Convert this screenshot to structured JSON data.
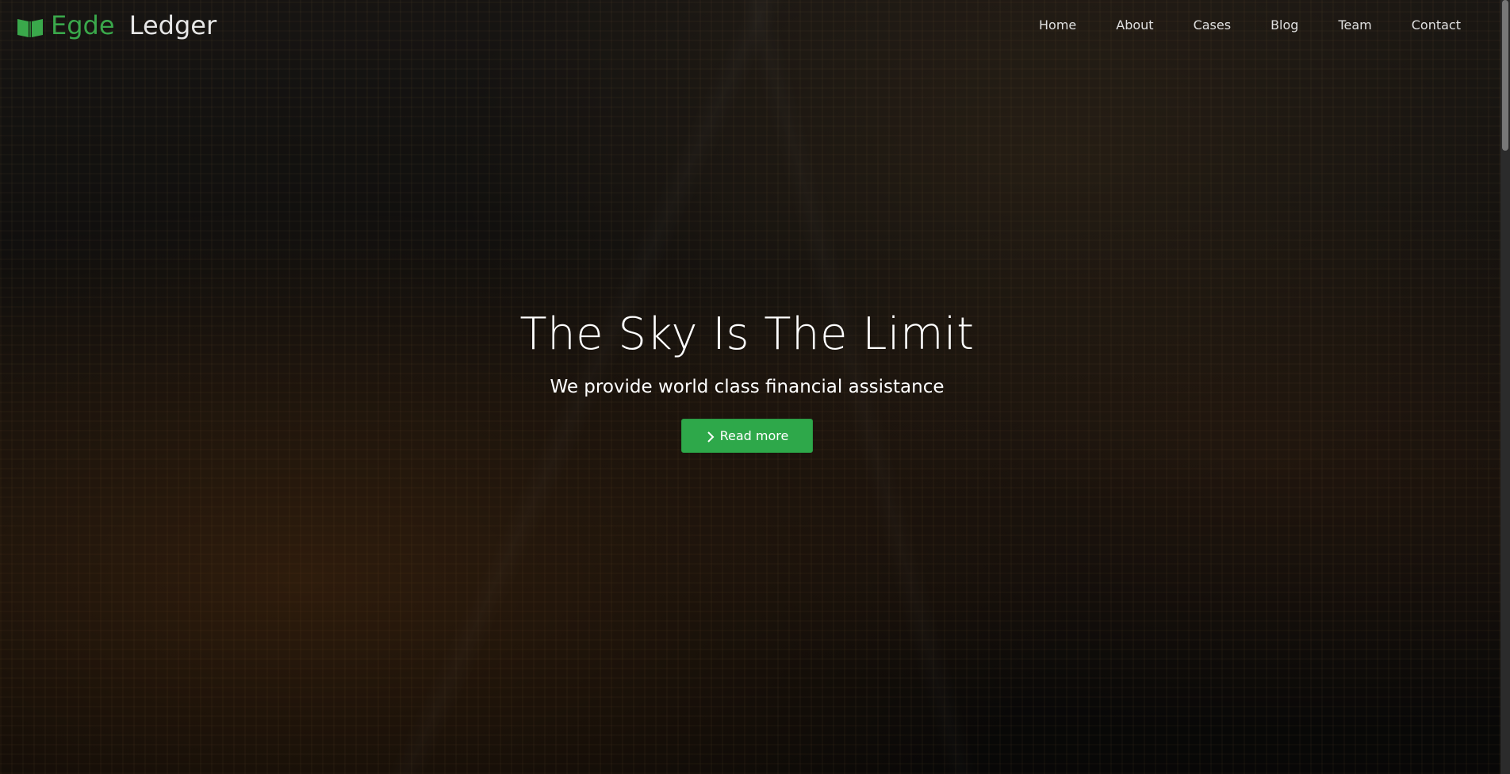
{
  "brand": {
    "name_accent": "Egde",
    "name_rest": " Ledger",
    "icon": "book-open-icon",
    "accent_color": "#3aa84b"
  },
  "nav": {
    "items": [
      {
        "label": "Home"
      },
      {
        "label": "About"
      },
      {
        "label": "Cases"
      },
      {
        "label": "Blog"
      },
      {
        "label": "Team"
      },
      {
        "label": "Contact"
      }
    ]
  },
  "hero": {
    "title": "The Sky Is The Limit",
    "subtitle": "We provide world class financial assistance",
    "cta_label": "Read more",
    "cta_icon": "chevron-right-icon",
    "cta_color": "#2ea84a"
  }
}
